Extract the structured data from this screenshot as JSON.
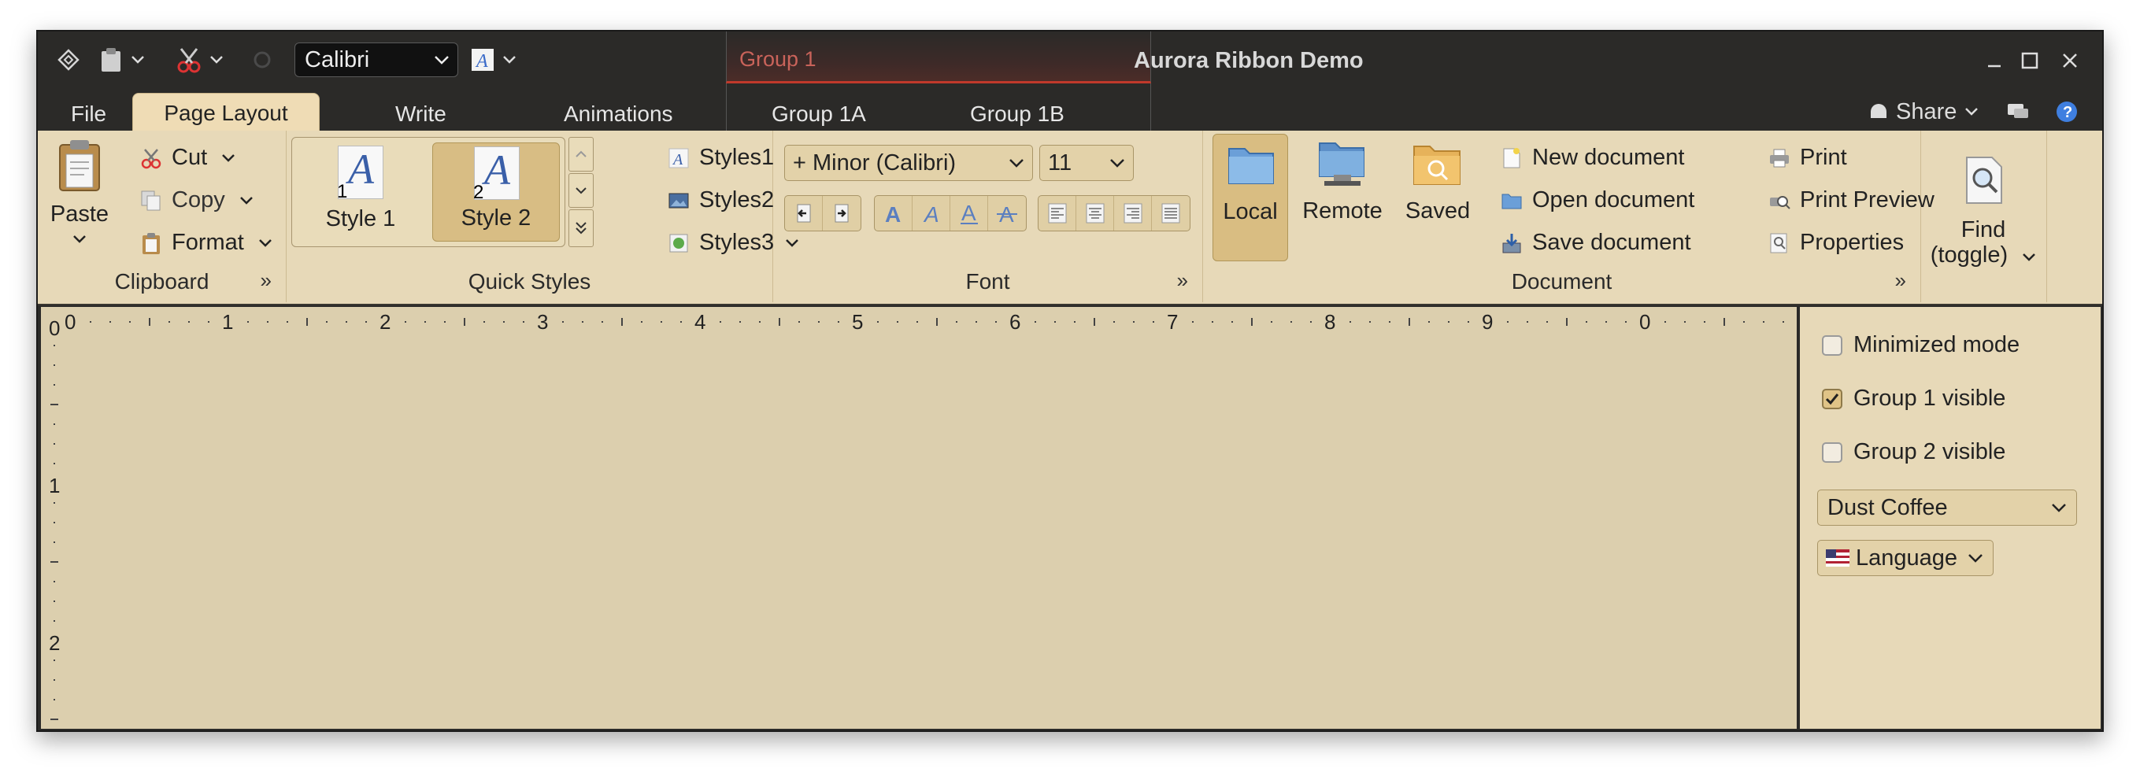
{
  "window": {
    "title": "Aurora Ribbon Demo"
  },
  "quick_access": {
    "font_combo_value": "Calibri"
  },
  "context_group": {
    "title": "Group 1"
  },
  "tabs": [
    {
      "label": "File"
    },
    {
      "label": "Page Layout"
    },
    {
      "label": "Write"
    },
    {
      "label": "Animations"
    },
    {
      "label": "Group 1A"
    },
    {
      "label": "Group 1B"
    }
  ],
  "right_tools": {
    "share_label": "Share"
  },
  "clipboard": {
    "paste_label": "Paste",
    "cut_label": "Cut",
    "copy_label": "Copy",
    "format_label": "Format",
    "band_title": "Clipboard"
  },
  "quick_styles": {
    "styles": [
      {
        "label": "Style 1",
        "number": "1"
      },
      {
        "label": "Style 2",
        "number": "2"
      }
    ],
    "menu": [
      {
        "label": "Styles1"
      },
      {
        "label": "Styles2"
      },
      {
        "label": "Styles3"
      }
    ],
    "band_title": "Quick Styles"
  },
  "font": {
    "family_value": "+ Minor (Calibri)",
    "size_value": "11",
    "band_title": "Font"
  },
  "document": {
    "locations": [
      {
        "label": "Local"
      },
      {
        "label": "Remote"
      },
      {
        "label": "Saved"
      }
    ],
    "actions": [
      {
        "label": "New document"
      },
      {
        "label": "Open document"
      },
      {
        "label": "Save document"
      }
    ],
    "print_actions": [
      {
        "label": "Print"
      },
      {
        "label": "Print Preview"
      },
      {
        "label": "Properties"
      }
    ],
    "band_title": "Document"
  },
  "find": {
    "line1": "Find",
    "line2": "(toggle)"
  },
  "ruler": {
    "horizontal": [
      "0",
      "1",
      "2",
      "3",
      "4",
      "5",
      "6",
      "7",
      "8",
      "9",
      "0"
    ],
    "vertical": [
      "0",
      "1",
      "2"
    ]
  },
  "side_panel": {
    "minimized_mode": "Minimized mode",
    "group1_visible": "Group 1 visible",
    "group2_visible": "Group 2 visible",
    "skin_value": "Dust Coffee",
    "language_label": "Language"
  },
  "colors": {
    "ribbon_bg": "#e7d9b8",
    "title_bg": "#2b2a28",
    "selected": "#d9bd82",
    "context_accent": "#c0392b"
  }
}
